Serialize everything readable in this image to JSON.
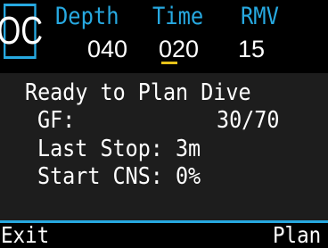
{
  "header": {
    "mode": "OC",
    "labels": {
      "depth": "Depth",
      "time": "Time",
      "rmv": "RMV"
    },
    "values": {
      "depth": "040",
      "time": "020",
      "rmv": "15"
    }
  },
  "body": {
    "title": "Ready to Plan Dive",
    "gf_label": "GF:",
    "gf_value": "30/70",
    "last_stop": "Last Stop: 3m",
    "start_cns": "Start CNS: 0%"
  },
  "footer": {
    "left": "Exit",
    "right": "Plan"
  },
  "colors": {
    "accent": "#27a9e1",
    "cursor": "#e7c21a",
    "panel": "#1d1d1d"
  }
}
